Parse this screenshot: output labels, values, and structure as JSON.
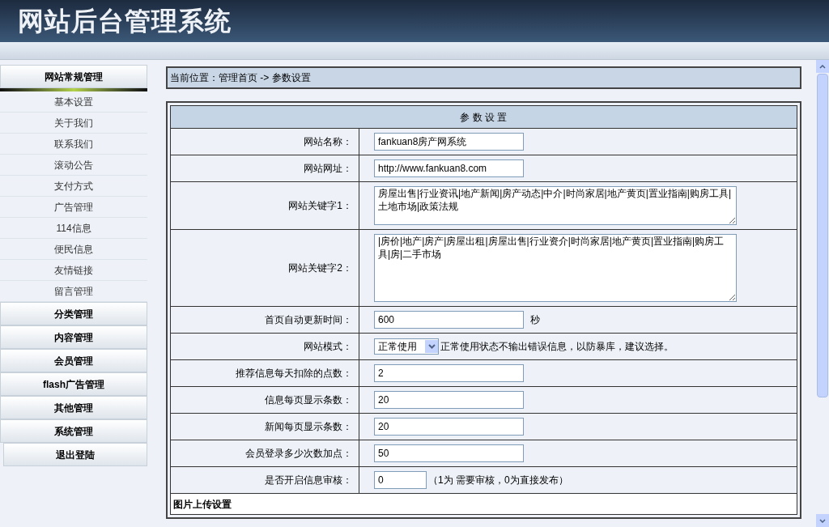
{
  "header": {
    "title": "网站后台管理系统"
  },
  "sidebar": {
    "groups": [
      {
        "label": "网站常规管理",
        "kind": "group",
        "expanded": true,
        "items": [
          "基本设置",
          "关于我们",
          "联系我们",
          "滚动公告",
          "支付方式",
          "广告管理",
          "114信息",
          "便民信息",
          "友情链接",
          "留言管理"
        ]
      },
      {
        "label": "分类管理",
        "kind": "group",
        "expanded": false
      },
      {
        "label": "内容管理",
        "kind": "group",
        "expanded": false
      },
      {
        "label": "会员管理",
        "kind": "group",
        "expanded": false
      },
      {
        "label": "flash广告管理",
        "kind": "group",
        "expanded": false
      },
      {
        "label": "其他管理",
        "kind": "group",
        "expanded": false
      },
      {
        "label": "系统管理",
        "kind": "group",
        "expanded": false
      },
      {
        "label": "退出登陆",
        "kind": "logout",
        "expanded": false
      }
    ]
  },
  "breadcrumb": "当前位置：管理首页 -> 参数设置",
  "form": {
    "title": "参 数 设 置",
    "rows": [
      {
        "label": "网站名称：",
        "kind": "input",
        "value": "fankuan8房产网系统"
      },
      {
        "label": "网站网址：",
        "kind": "input",
        "value": "http://www.fankuan8.com"
      },
      {
        "label": "网站关键字1：",
        "kind": "textarea",
        "value": "房屋出售|行业资讯|地产新闻|房产动态|中介|时尚家居|地产黄页|置业指南|购房工具|土地市场|政策法规"
      },
      {
        "label": "网站关键字2：",
        "kind": "textarea",
        "value": "|房价|地产|房产|房屋出租|房屋出售|行业资介|时尚家居|地产黄页|置业指南|购房工具|房|二手市场"
      },
      {
        "label": "首页自动更新时间：",
        "kind": "input",
        "value": "600",
        "suffix": "秒"
      },
      {
        "label": "网站模式：",
        "kind": "select",
        "value": "正常使用",
        "suffix": "正常使用状态不输出错误信息，以防暴库，建议选择。"
      },
      {
        "label": "推荐信息每天扣除的点数：",
        "kind": "input",
        "value": "2"
      },
      {
        "label": "信息每页显示条数：",
        "kind": "input",
        "value": "20"
      },
      {
        "label": "新闻每页显示条数：",
        "kind": "input",
        "value": "20"
      },
      {
        "label": "会员登录多少次数加点：",
        "kind": "input",
        "value": "50"
      },
      {
        "label": "是否开启信息审核：",
        "kind": "short",
        "value": "0",
        "suffix": "（1为 需要审核，0为直接发布）"
      }
    ],
    "section": "图片上传设置"
  }
}
